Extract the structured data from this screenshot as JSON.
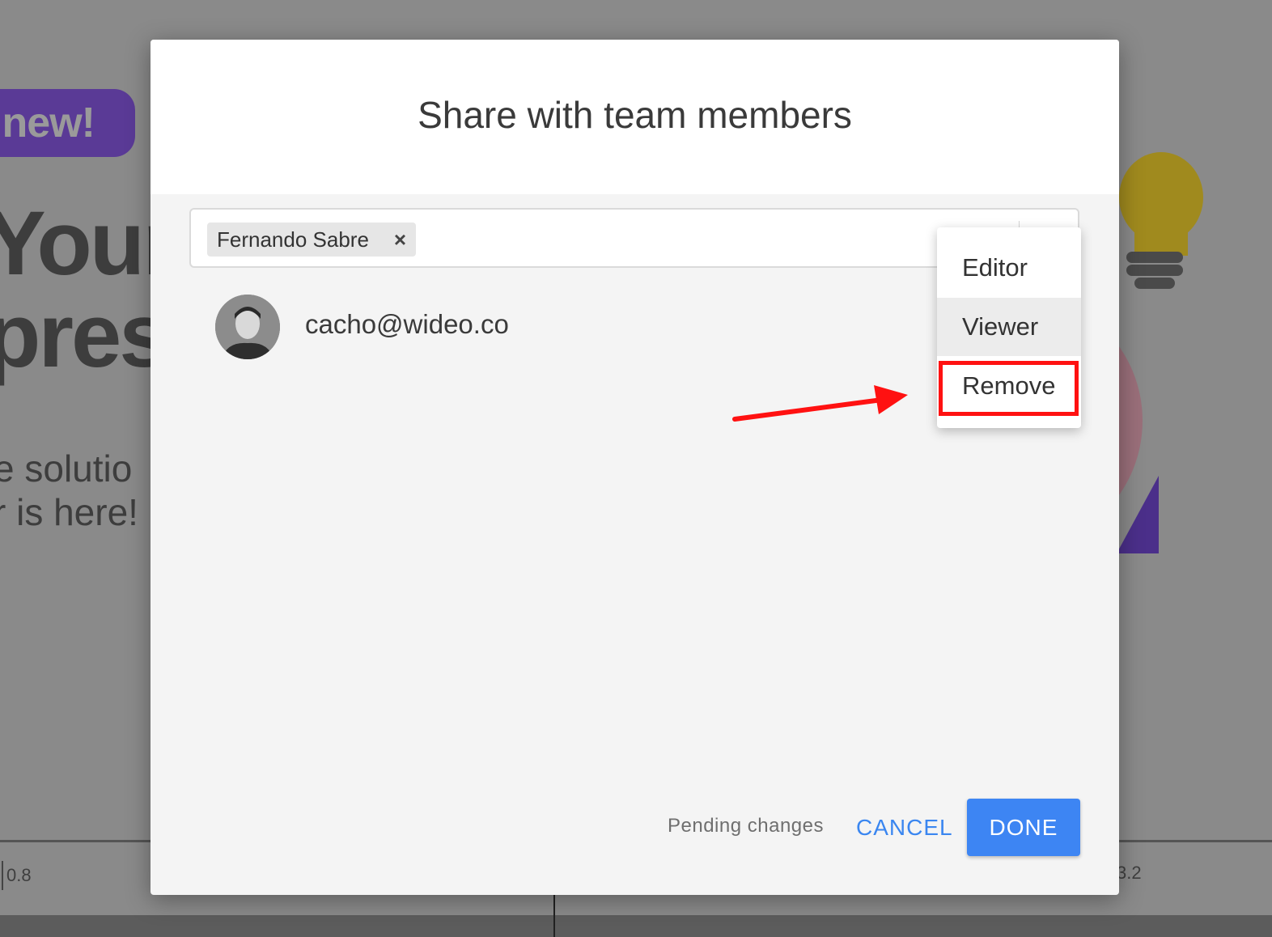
{
  "background": {
    "badge": "new!",
    "headline_line1": "Your",
    "headline_line2": "prese",
    "sub_line1": "e solutio",
    "sub_line2": "r is here!",
    "timeline_left_tick": "0.8",
    "timeline_right_tick": "3.2"
  },
  "dialog": {
    "title": "Share with team members",
    "chip_label": "Fernando Sabre",
    "chip_remove": "×",
    "member_email": "cacho@wideo.co",
    "status": "Pending changes",
    "cancel_label": "CANCEL",
    "done_label": "DONE"
  },
  "role_menu": {
    "items": [
      "Editor",
      "Viewer",
      "Remove"
    ],
    "hovered": "Viewer",
    "highlighted": "Remove"
  },
  "colors": {
    "primary": "#3d85f3",
    "link": "#3a86f0",
    "highlight": "#ff1111",
    "annotation_arrow": "#ff1111"
  }
}
